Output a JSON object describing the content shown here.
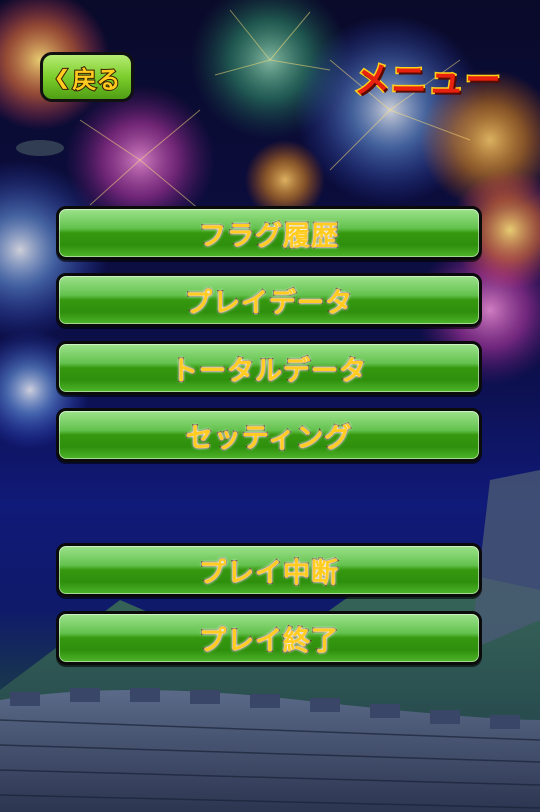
{
  "header": {
    "back_label": "戻る",
    "back_icon": "chevron-left-icon",
    "title": "メニュー"
  },
  "menu": {
    "items": [
      {
        "label": "フラグ履歴"
      },
      {
        "label": "プレイデータ"
      },
      {
        "label": "トータルデータ"
      },
      {
        "label": "セッティング"
      }
    ],
    "lower_items": [
      {
        "label": "プレイ中断"
      },
      {
        "label": "プレイ終了"
      }
    ]
  },
  "colors": {
    "button_green": "#36980f",
    "label_yellow": "#ffcc1f",
    "title_red": "#e8220f"
  }
}
